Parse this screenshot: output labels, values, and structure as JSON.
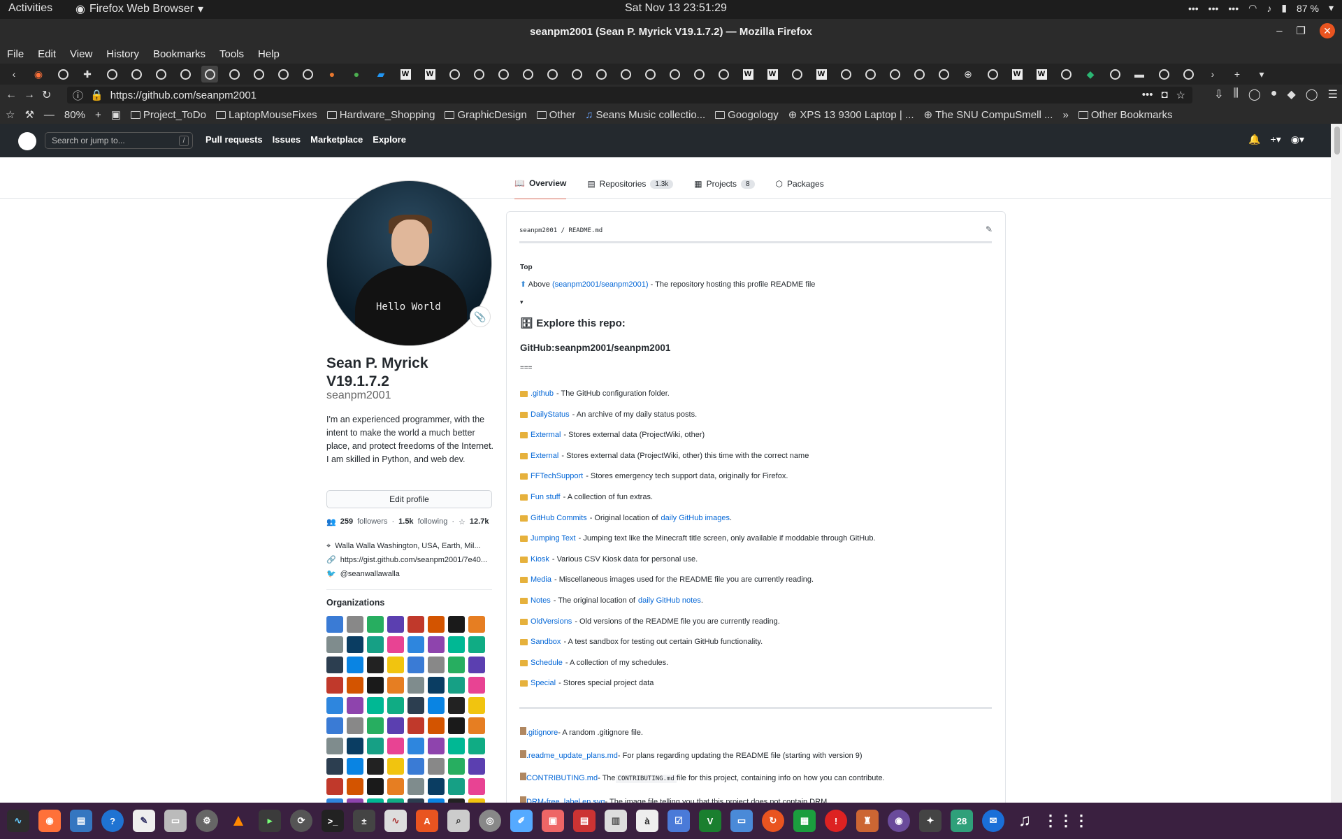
{
  "system": {
    "activities": "Activities",
    "app_name": "Firefox Web Browser",
    "clock": "Sat Nov 13  23:51:29",
    "battery": "87 %"
  },
  "window": {
    "title": "seanpm2001 (Sean P. Myrick V19.1.7.2) — Mozilla Firefox"
  },
  "menu": [
    "File",
    "Edit",
    "View",
    "History",
    "Bookmarks",
    "Tools",
    "Help"
  ],
  "address": {
    "url": "https://github.com/seanpm2001",
    "zoom": "80%"
  },
  "bookmarks": [
    {
      "label": "Project_ToDo",
      "icon": "folder-icon"
    },
    {
      "label": "LaptopMouseFixes",
      "icon": "folder-icon"
    },
    {
      "label": "Hardware_Shopping",
      "icon": "folder-icon"
    },
    {
      "label": "GraphicDesign",
      "icon": "folder-icon"
    },
    {
      "label": "Other",
      "icon": "folder-icon"
    },
    {
      "label": "Seans Music collectio...",
      "icon": "music-icon"
    },
    {
      "label": "Googology",
      "icon": "folder-icon"
    },
    {
      "label": "XPS 13 9300 Laptop | ...",
      "icon": "globe-icon"
    },
    {
      "label": "The SNU CompuSmell ...",
      "icon": "globe-icon"
    }
  ],
  "other_bookmarks": "Other Bookmarks",
  "github": {
    "search_placeholder": "Search or jump to...",
    "search_key": "/",
    "nav": [
      "Pull requests",
      "Issues",
      "Marketplace",
      "Explore"
    ]
  },
  "profile_tabs": [
    {
      "label": "Overview",
      "count": ""
    },
    {
      "label": "Repositories",
      "count": "1.3k"
    },
    {
      "label": "Projects",
      "count": "8"
    },
    {
      "label": "Packages",
      "count": ""
    }
  ],
  "profile": {
    "avatar_text": "Hello World",
    "name": "Sean P. Myrick V19.1.7.2",
    "username": "seanpm2001",
    "bio": "I'm an experienced programmer, with the intent to make the world a much better place, and protect freedoms of the Internet. I am skilled in Python, and web dev.",
    "edit_label": "Edit profile",
    "followers": "259",
    "followers_label": "followers",
    "following": "1.5k",
    "following_label": "following",
    "stars": "12.7k",
    "location": "Walla Walla Washington, USA, Earth, Mil...",
    "website": "https://gist.github.com/seanpm2001/7e40...",
    "twitter": "@seanwallawalla",
    "organizations_title": "Organizations"
  },
  "readme": {
    "path": "seanpm2001 / README.md",
    "top": "Top",
    "above_prefix": "Above",
    "above_link": "(seanpm2001/seanpm2001)",
    "above_suffix": "- The repository hosting this profile README file",
    "toggle": "▾",
    "explore": "Explore this repo:",
    "heading": "GitHub:seanpm2001/seanpm2001",
    "separator": "===",
    "folders": [
      {
        "link": ".github",
        "desc": "- The GitHub configuration folder."
      },
      {
        "link": "DailyStatus",
        "desc": "- An archive of my daily status posts."
      },
      {
        "link": "Extermal",
        "desc": "- Stores external data (ProjectWiki, other)"
      },
      {
        "link": "External",
        "desc": "- Stores external data (ProjectWiki, other) this time with the correct name"
      },
      {
        "link": "FFTechSupport",
        "desc": "- Stores emergency tech support data, originally for Firefox."
      },
      {
        "link": "Fun stuff",
        "desc": "- A collection of fun extras."
      },
      {
        "link": "GitHub Commits",
        "desc": "- Original location of",
        "link2": "daily GitHub images",
        "tail": "."
      },
      {
        "link": "Jumping Text",
        "desc": "- Jumping text like the Minecraft title screen, only available if moddable through GitHub."
      },
      {
        "link": "Kiosk",
        "desc": "- Various CSV Kiosk data for personal use."
      },
      {
        "link": "Media",
        "desc": "- Miscellaneous images used for the README file you are currently reading."
      },
      {
        "link": "Notes",
        "desc": "- The original location of",
        "link2": "daily GitHub notes",
        "tail": "."
      },
      {
        "link": "OldVersions",
        "desc": "- Old versions of the README file you are currently reading."
      },
      {
        "link": "Sandbox",
        "desc": "- A test sandbox for testing out certain GitHub functionality."
      },
      {
        "link": "Schedule",
        "desc": "- A collection of my schedules."
      },
      {
        "link": "Special",
        "desc": "- Stores special project data"
      }
    ],
    "files": [
      {
        "link": ".gitignore",
        "desc": "- A random .gitignore file."
      },
      {
        "link": ".readme_update_plans.md",
        "desc": "- For plans regarding updating the README file (starting with version 9)"
      },
      {
        "link": "CONTRIBUTING.md",
        "desc": "- The",
        "code": "CONTRIBUTING.md",
        "tail": "file for this project, containing info on how you can contribute."
      },
      {
        "link": "DRM-free_label.en.svg",
        "desc": "- The image file telling you that this project does not contain DRM."
      }
    ]
  },
  "dock_calendar": "28",
  "colors": {
    "accent_link": "#0366d6",
    "tab_underline": "#f9826c",
    "gh_header": "#24292e"
  }
}
